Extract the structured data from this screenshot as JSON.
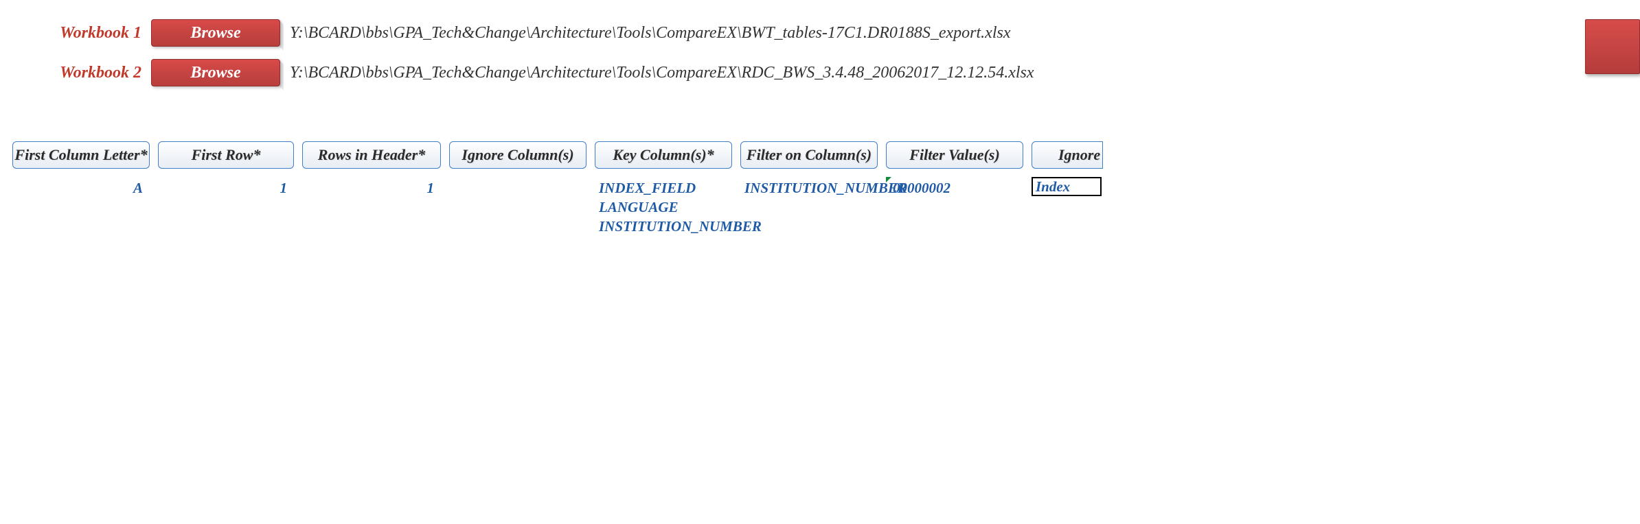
{
  "workbooks": [
    {
      "label": "Workbook 1",
      "browse_label": "Browse",
      "path": "Y:\\BCARD\\bbs\\GPA_Tech&Change\\Architecture\\Tools\\CompareEX\\BWT_tables-17C1.DR0188S_export.xlsx"
    },
    {
      "label": "Workbook 2",
      "browse_label": "Browse",
      "path": "Y:\\BCARD\\bbs\\GPA_Tech&Change\\Architecture\\Tools\\CompareEX\\RDC_BWS_3.4.48_20062017_12.12.54.xlsx"
    }
  ],
  "columns": {
    "first_column_letter": {
      "header": "First Column Letter*",
      "value": "A"
    },
    "first_row": {
      "header": "First Row*",
      "value": "1"
    },
    "rows_in_header": {
      "header": "Rows in Header*",
      "value": "1"
    },
    "ignore_columns": {
      "header": "Ignore Column(s)",
      "value": ""
    },
    "key_columns": {
      "header": "Key Column(s)*",
      "values": [
        "INDEX_FIELD",
        "LANGUAGE",
        "INSTITUTION_NUMBER"
      ]
    },
    "filter_on_columns": {
      "header": "Filter on Column(s)",
      "value": "INSTITUTION_NUMBER"
    },
    "filter_values": {
      "header": "Filter Value(s)",
      "value": "00000002"
    },
    "ignore_last": {
      "header": "Ignore",
      "value": "Index"
    }
  }
}
